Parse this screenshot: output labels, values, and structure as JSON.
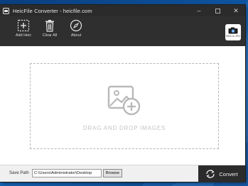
{
  "window": {
    "title": "HeicFile Converter - heicfile.com"
  },
  "toolbar": {
    "add_label": "Add Heic",
    "clear_label": "Clear All",
    "about_label": "About",
    "badge_label": "HEIC to JPG"
  },
  "dropzone": {
    "text": "DRAG AND DROP IMAGES"
  },
  "bottom": {
    "save_label": "Save Path",
    "save_path": "C:\\Users\\Administrator\\Desktop",
    "browse_label": "Browse",
    "convert_label": "Convert"
  },
  "colors": {
    "titlebar": "#2b2b2b",
    "toolbar": "#2f2f2f",
    "dropzone_border": "#b5b5b5",
    "convert_bg": "#2b2b2b"
  },
  "icons": [
    "app-icon",
    "minimize-icon",
    "maximize-icon",
    "close-icon",
    "add-file-icon",
    "trash-icon",
    "compass-icon",
    "camera-badge-icon",
    "add-image-icon",
    "convert-icon"
  ]
}
